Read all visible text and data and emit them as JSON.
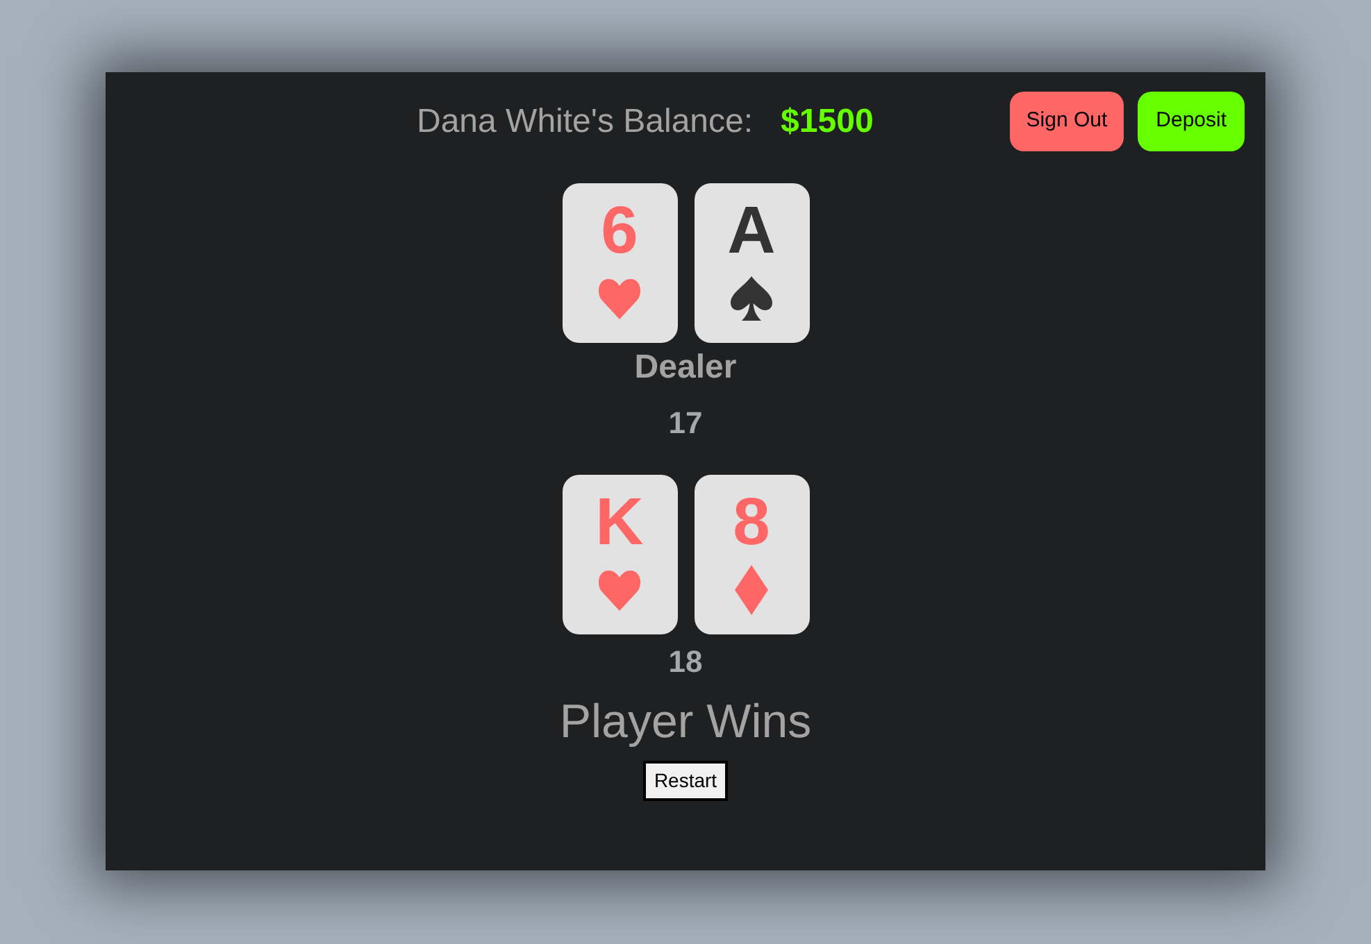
{
  "header": {
    "label": "Dana White's Balance:",
    "balance": "$1500"
  },
  "buttons": [
    {
      "label": "Sign Out",
      "kind": "danger"
    },
    {
      "label": "Deposit",
      "kind": "success"
    }
  ],
  "dealer": {
    "cards": [
      {
        "rank": "6",
        "kind": "hearts"
      },
      {
        "rank": "A",
        "kind": "spades"
      }
    ],
    "label": "Dealer",
    "total": "17"
  },
  "player": {
    "cards": [
      {
        "rank": "K",
        "kind": "hearts"
      },
      {
        "rank": "8",
        "kind": "diamonds"
      }
    ],
    "total": "18"
  },
  "result": "Player Wins",
  "restart_button": "Restart"
}
